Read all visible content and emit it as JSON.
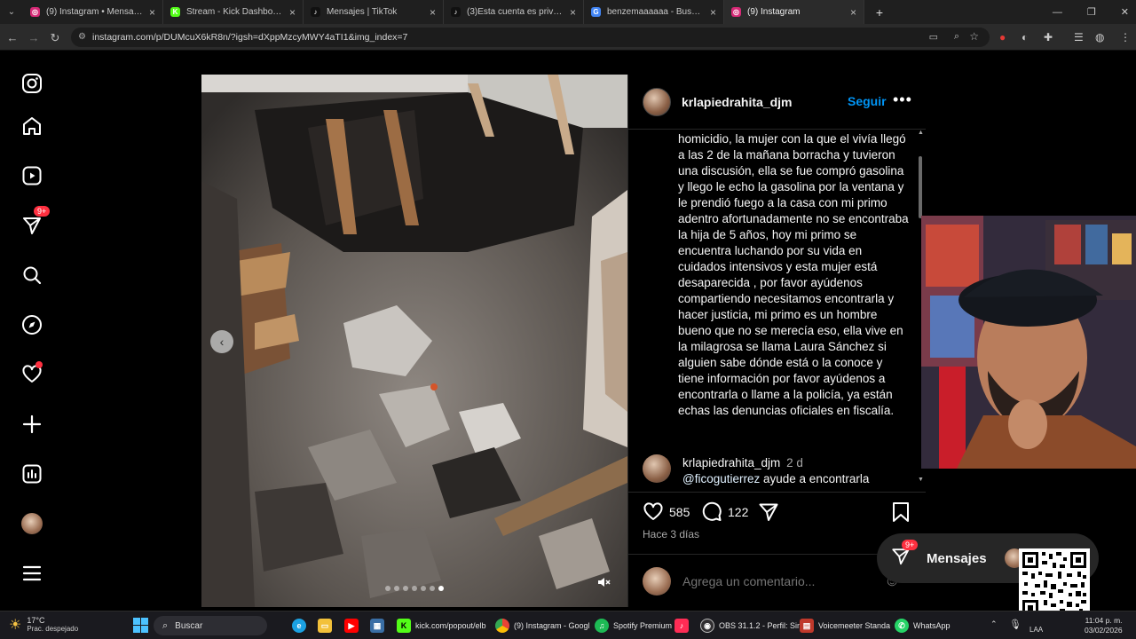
{
  "browser": {
    "tabs": [
      {
        "title": "(9) Instagram • Mensajes",
        "color": "#d62976",
        "glyph": "◎"
      },
      {
        "title": "Stream - Kick Dashboard",
        "color": "#53fc18",
        "glyph": "K"
      },
      {
        "title": "Mensajes | TikTok",
        "color": "#111111",
        "glyph": "♪"
      },
      {
        "title": "(3)Esta cuenta es privada. Sigue",
        "color": "#111111",
        "glyph": "♪"
      },
      {
        "title": "benzemaaaaaa - Buscar con Go",
        "color": "#4285f4",
        "glyph": "G"
      },
      {
        "title": "(9) Instagram",
        "color": "#d62976",
        "glyph": "◎"
      }
    ],
    "url": "instagram.com/p/DUMcuX6kR8n/?igsh=dXppMzcyMWY4aTI1&img_index=7"
  },
  "sidebar": {
    "messages_badge": "9+"
  },
  "post": {
    "username": "krlapiedrahita_djm",
    "follow_label": "Seguir",
    "caption": "homicidio, la mujer con la que el vivía llegó a las 2 de la mañana borracha y tuvieron una discusión, ella se fue compró gasolina y llego le echo la gasolina por la ventana y le prendió fuego a la casa con mi primo adentro afortunadamente no se encontraba la hija de 5 años, hoy mi primo se encuentra luchando por su vida en cuidados intensivos y esta mujer está desaparecida , por favor ayúdenos compartiendo necesitamos encontrarla y hacer justicia, mi primo es un hombre bueno que no se merecía eso, ella vive en la milagrosa se llama Laura Sánchez si alguien sabe dónde está o la conoce y tiene información por favor ayúdenos a encontrarla o llame a la policía, ya están echas las denuncias oficiales en fiscalía.",
    "comment": {
      "username": "krlapiedrahita_djm",
      "age": "2 d",
      "mention": "@ficogutierrez",
      "text": "ayude a encontrarla"
    },
    "likes": "585",
    "comments": "122",
    "posted": "Hace 3 días",
    "comment_placeholder": "Agrega un comentario...",
    "carousel": {
      "count": 7,
      "active": 6
    }
  },
  "messages": {
    "label": "Mensajes",
    "badge": "9+"
  },
  "taskbar": {
    "weather_temp": "17°C",
    "weather_desc": "Prac. despejado",
    "search": "Buscar",
    "apps": [
      {
        "label": "kick.com/popout/elb",
        "color": "#53fc18",
        "glyph": "K"
      },
      {
        "label": "(9) Instagram - Googl",
        "color": "#4285f4",
        "glyph": "●"
      },
      {
        "label": "Spotify Premium",
        "color": "#1db954",
        "glyph": "♫"
      },
      {
        "label": "OBS 31.1.2 - Perfil: Sin",
        "color": "#302e31",
        "glyph": "◉"
      },
      {
        "label": "Voicemeeter Standa",
        "color": "#c0392b",
        "glyph": "▤"
      },
      {
        "label": "WhatsApp",
        "color": "#25d366",
        "glyph": "✆"
      }
    ],
    "lang": "LAA",
    "time": "11:04 p. m.",
    "date": "03/02/2026"
  }
}
